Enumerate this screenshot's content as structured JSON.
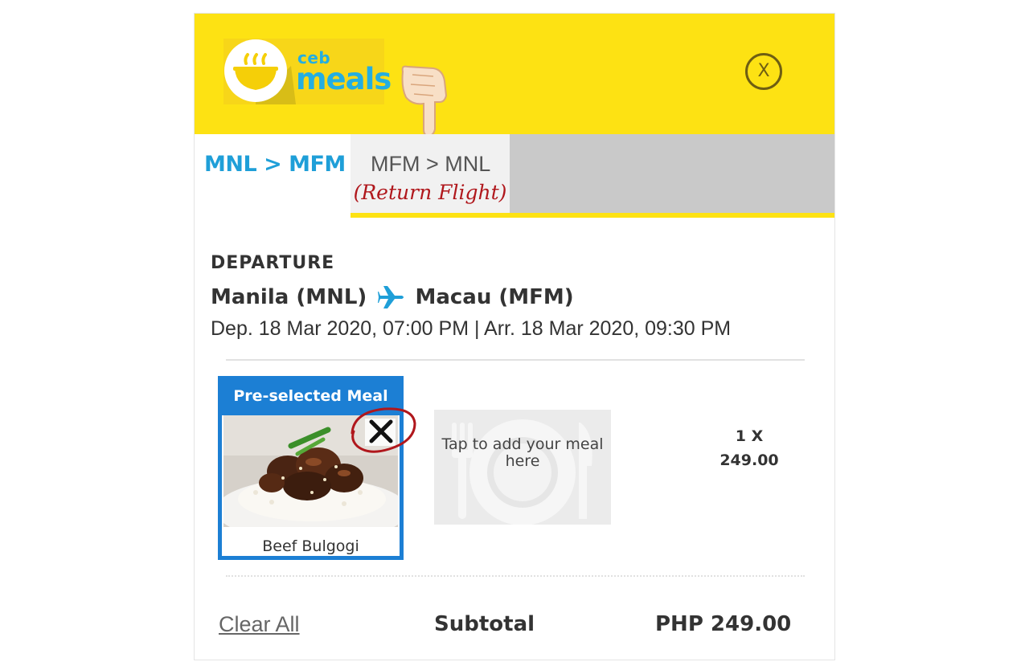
{
  "header": {
    "logo": {
      "line1": "ceb",
      "line2": "meals"
    },
    "close_icon": "close-icon",
    "close_label": "X",
    "annotation_icon": "pointing-hand-icon"
  },
  "tabs": [
    {
      "label": "MNL > MFM",
      "active": true
    },
    {
      "label": "MFM > MNL",
      "note": "(Return Flight)",
      "active": false
    }
  ],
  "flight": {
    "section_label": "DEPARTURE",
    "origin": "Manila (MNL)",
    "destination": "Macau (MFM)",
    "route_icon": "airplane-icon",
    "times": "Dep. 18 Mar 2020, 07:00 PM | Arr. 18 Mar 2020, 09:30 PM"
  },
  "meal": {
    "header": "Pre-selected Meal",
    "name": "Beef Bulgogi",
    "remove_icon": "remove-x-icon",
    "remove_label": "✕"
  },
  "add_meal": {
    "text": "Tap to add your meal here",
    "icon": "plate-icon"
  },
  "quantity": {
    "line1": "1 X",
    "line2": "249.00"
  },
  "footer": {
    "clear_all": "Clear All",
    "subtotal_label": "Subtotal",
    "subtotal_value": "PHP 249.00"
  },
  "colors": {
    "brand_yellow": "#fde213",
    "brand_blue": "#24aee1",
    "meal_card_blue": "#1c7fd4",
    "annotation_red": "#b0171c"
  }
}
